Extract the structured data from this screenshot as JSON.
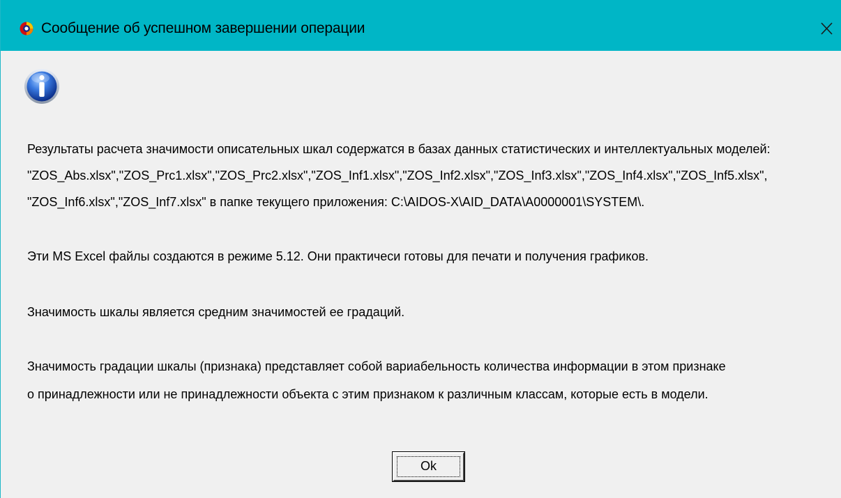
{
  "window": {
    "title": "Сообщение об успешном завершении операции",
    "close_glyph": "✕",
    "accent": "#00b6c6"
  },
  "icons": {
    "app": "aidos-app-icon",
    "info": "information-icon",
    "close": "close-icon"
  },
  "message": {
    "lines": [
      "Результаты расчета значимости описательных шкал содержатся в базах данных статистических и интеллектуальных моделей:",
      "\"ZOS_Abs.xlsx\",\"ZOS_Prc1.xlsx\",\"ZOS_Prc2.xlsx\",\"ZOS_Inf1.xlsx\",\"ZOS_Inf2.xlsx\",\"ZOS_Inf3.xlsx\",\"ZOS_Inf4.xlsx\",\"ZOS_Inf5.xlsx\",",
      "\"ZOS_Inf6.xlsx\",\"ZOS_Inf7.xlsx\" в папке текущего приложения: C:\\AIDOS-X\\AID_DATA\\A0000001\\SYSTEM\\.",
      "Эти MS Excel файлы создаются в режиме 5.12. Они практичеси готовы для печати и получения графиков.",
      "Значимость шкалы является средним значимостей ее градаций.",
      "Значимость градации шкалы (признака) представляет собой вариабельность количества информации в этом признаке",
      "о принадлежности или не принадлежности объекта с этим признаком к различным классам, которые есть в модели."
    ]
  },
  "buttons": {
    "ok_label": "Ok"
  }
}
